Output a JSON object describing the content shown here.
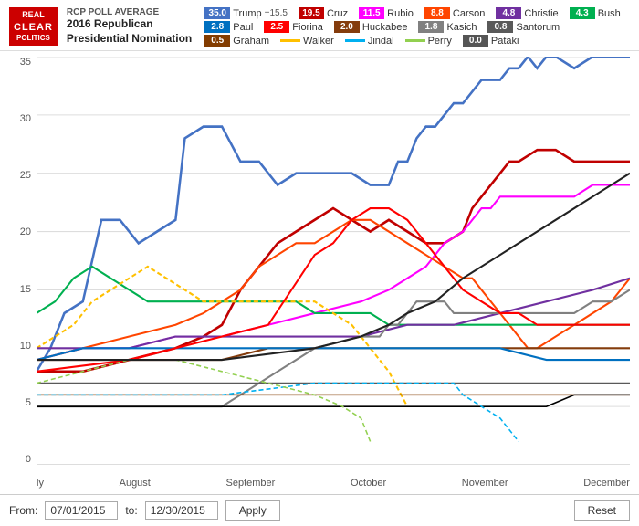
{
  "header": {
    "logo": {
      "line1": "REAL",
      "line2": "CLEAR",
      "line3": "POLITICS"
    },
    "rcp_label": "RCP POLL AVERAGE",
    "chart_title": "2016 Republican\nPresidential Nomination"
  },
  "legend": [
    {
      "name": "Trump",
      "value": "35.0",
      "change": "+15.5",
      "color": "#4472C4",
      "type": "badge"
    },
    {
      "name": "Cruz",
      "value": "19.5",
      "color": "#C00000",
      "type": "badge"
    },
    {
      "name": "Rubio",
      "value": "11.5",
      "color": "#FF00FF",
      "type": "badge"
    },
    {
      "name": "Carson",
      "value": "8.8",
      "color": "#FF4500",
      "type": "badge"
    },
    {
      "name": "Christie",
      "value": "4.8",
      "color": "#7030A0",
      "type": "badge"
    },
    {
      "name": "Bush",
      "value": "4.3",
      "color": "#00B050",
      "type": "badge"
    },
    {
      "name": "Paul",
      "value": "2.8",
      "color": "#0070C0",
      "type": "badge"
    },
    {
      "name": "Fiorina",
      "value": "2.5",
      "color": "#FF0000",
      "type": "badge"
    },
    {
      "name": "Huckabee",
      "value": "2.0",
      "color": "#843C0C",
      "type": "badge"
    },
    {
      "name": "Kasich",
      "value": "1.8",
      "color": "#808080",
      "type": "badge"
    },
    {
      "name": "Santorum",
      "value": "0.8",
      "color": "#595959",
      "type": "badge"
    },
    {
      "name": "Graham",
      "value": "0.5",
      "color": "#833C00",
      "type": "badge"
    },
    {
      "name": "Walker",
      "value": "--",
      "color": "#FFC000",
      "type": "dash"
    },
    {
      "name": "Jindal",
      "value": "--",
      "color": "#00B0F0",
      "type": "dash"
    },
    {
      "name": "Perry",
      "value": "--",
      "color": "#92D050",
      "type": "dash"
    },
    {
      "name": "Pataki",
      "value": "0.0",
      "color": "#000000",
      "type": "badge"
    }
  ],
  "yaxis": {
    "labels": [
      "35",
      "30",
      "25",
      "20",
      "15",
      "10",
      "5",
      "0"
    ]
  },
  "xaxis": {
    "labels": [
      "ly",
      "August",
      "September",
      "October",
      "November",
      "December"
    ]
  },
  "footer": {
    "from_label": "From:",
    "from_value": "07/01/2015",
    "to_label": "to:",
    "to_value": "12/30/2015",
    "apply_label": "Apply",
    "reset_label": "Reset"
  }
}
